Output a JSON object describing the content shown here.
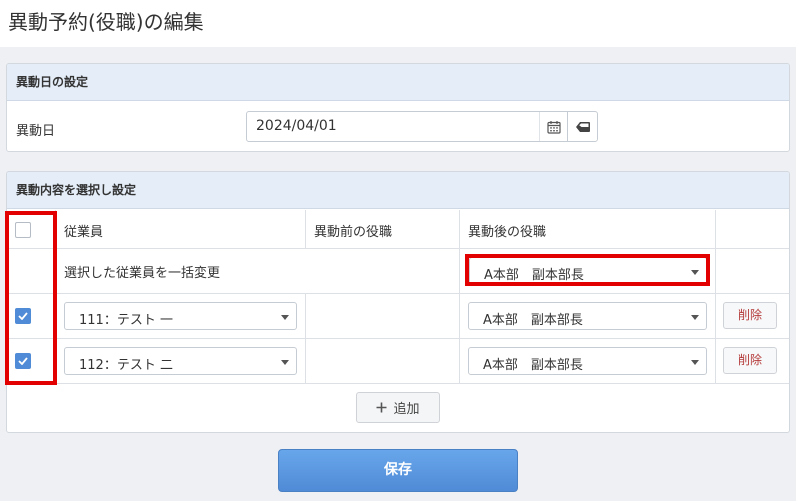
{
  "page": {
    "title": "異動予約(役職)の編集"
  },
  "date_section": {
    "heading": "異動日の設定",
    "label": "異動日",
    "value": "2024/04/01"
  },
  "transfer_section": {
    "heading": "異動内容を選択し設定",
    "columns": {
      "employee": "従業員",
      "before": "異動前の役職",
      "after": "異動後の役職"
    },
    "bulk": {
      "label": "選択した従業員を一括変更",
      "value": "A本部　副本部長"
    },
    "rows": [
      {
        "checked": true,
        "employee": "111：テスト 一",
        "after": "A本部　副本部長",
        "delete_label": "削除"
      },
      {
        "checked": true,
        "employee": "112：テスト 二",
        "after": "A本部　副本部長",
        "delete_label": "削除"
      }
    ],
    "add_label": "追加"
  },
  "save_label": "保存",
  "colors": {
    "accent": "#4f8bd6",
    "highlight": "#e30000",
    "delete_text": "#b53a3a",
    "panel_header": "#e4edf8"
  }
}
